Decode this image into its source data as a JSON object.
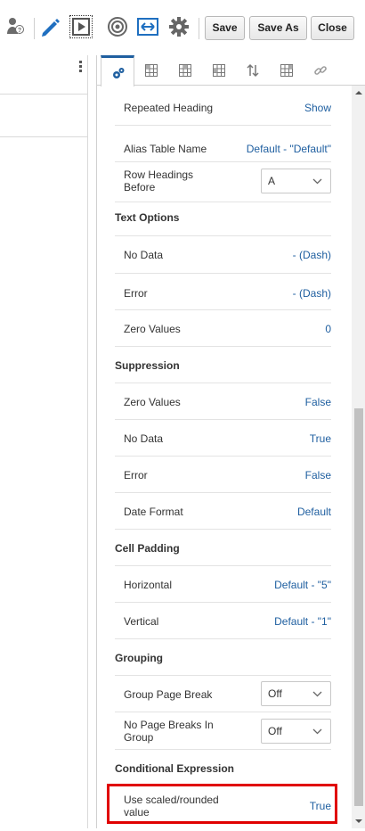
{
  "toolbar": {
    "icons": [
      "user-help-icon",
      "pencil-icon",
      "run-icon",
      "target-icon",
      "resize-horizontal-icon",
      "gear-icon"
    ],
    "save_label": "Save",
    "save_as_label": "Save As",
    "close_label": "Close"
  },
  "tabs": [
    "settings-tab",
    "grid-tab-1",
    "grid-tab-2",
    "grid-tab-3",
    "sort-tab",
    "grid-tab-4",
    "link-tab"
  ],
  "rows": {
    "repeated_heading": {
      "label": "Repeated Heading",
      "value": "Show"
    },
    "alias_table": {
      "label": "Alias Table Name",
      "value": "Default - \"Default\""
    },
    "row_headings_before": {
      "label1": "Row Headings",
      "label2": "Before",
      "value": "A"
    }
  },
  "text_options": {
    "title": "Text Options",
    "no_data": {
      "label": "No Data",
      "value": "- (Dash)"
    },
    "error": {
      "label": "Error",
      "value": "- (Dash)"
    },
    "zero_values": {
      "label": "Zero Values",
      "value": "0"
    }
  },
  "suppression": {
    "title": "Suppression",
    "zero_values": {
      "label": "Zero Values",
      "value": "False"
    },
    "no_data": {
      "label": "No Data",
      "value": "True"
    },
    "error": {
      "label": "Error",
      "value": "False"
    },
    "date_format": {
      "label": "Date Format",
      "value": "Default"
    }
  },
  "cell_padding": {
    "title": "Cell Padding",
    "horizontal": {
      "label": "Horizontal",
      "value": "Default - \"5\""
    },
    "vertical": {
      "label": "Vertical",
      "value": "Default - \"1\""
    }
  },
  "grouping": {
    "title": "Grouping",
    "group_page_break": {
      "label": "Group Page Break",
      "value": "Off"
    },
    "no_page_breaks": {
      "label1": "No Page Breaks In",
      "label2": "Group",
      "value": "Off"
    }
  },
  "conditional_expression": {
    "title": "Conditional Expression",
    "use_scaled": {
      "label1": "Use scaled/rounded",
      "label2": "value",
      "value": "True"
    }
  },
  "colors": {
    "accent": "#1f5fa0",
    "highlight": "#e00000"
  }
}
